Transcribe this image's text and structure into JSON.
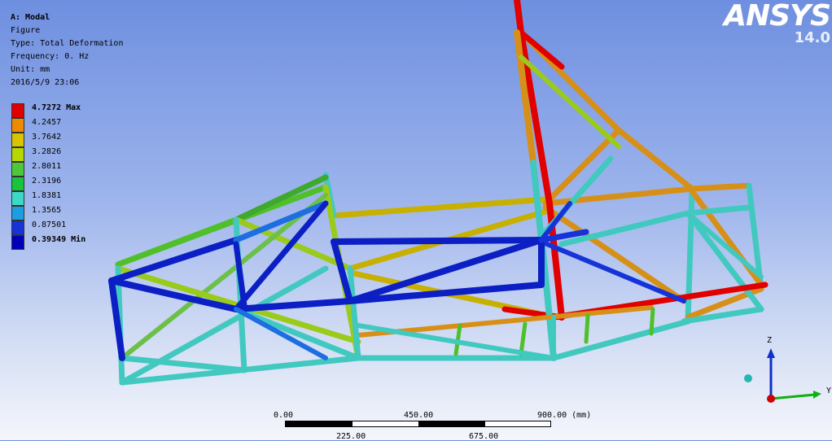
{
  "header": {
    "title": "A: Modal",
    "lines": [
      "Figure",
      "Type: Total Deformation",
      "Frequency: 0. Hz",
      "Unit: mm",
      "2016/5/9 23:06"
    ]
  },
  "legend": {
    "entries": [
      {
        "label": "4.7272 Max",
        "color": "#e00000",
        "bold": true
      },
      {
        "label": "4.2457",
        "color": "#ee8a00",
        "bold": false
      },
      {
        "label": "3.7642",
        "color": "#d8c400",
        "bold": false
      },
      {
        "label": "3.2826",
        "color": "#b5d800",
        "bold": false
      },
      {
        "label": "2.8011",
        "color": "#4ec83a",
        "bold": false
      },
      {
        "label": "2.3196",
        "color": "#19c33c",
        "bold": false
      },
      {
        "label": "1.8381",
        "color": "#3cd9c6",
        "bold": false
      },
      {
        "label": "1.3565",
        "color": "#1d9ee0",
        "bold": false
      },
      {
        "label": "0.87501",
        "color": "#1633d8",
        "bold": false
      },
      {
        "label": "0.39349 Min",
        "color": "#0000b8",
        "bold": true
      }
    ]
  },
  "logo": {
    "name": "ANSYS",
    "version": "14.0"
  },
  "scale_bar": {
    "top_labels": [
      "0.00",
      "450.00",
      "900.00 (mm)"
    ],
    "bottom_labels": [
      "225.00",
      "675.00"
    ]
  },
  "triad": {
    "z": "Z",
    "y": "Y"
  },
  "colors": {
    "background_top": "#6e8fe0",
    "background_bottom": "#f4f6fb"
  }
}
